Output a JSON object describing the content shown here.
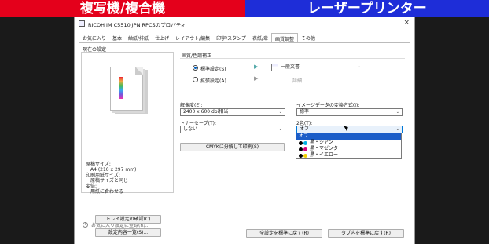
{
  "banners": {
    "left": "複写機/複合機",
    "right": "レーザープリンター"
  },
  "window": {
    "title": "RICOH IM C5510 JPN RPCSのプロパティ",
    "close": "×"
  },
  "tabs": [
    "お気に入り",
    "基本",
    "給紙/排紙",
    "仕上げ",
    "レイアウト/編集",
    "印字/スタンプ",
    "表紙/章",
    "画質調整",
    "その他"
  ],
  "active_tab": "画質調整",
  "left_panel": {
    "preview_label": "現在の設定",
    "info": [
      "原稿サイズ:",
      "A4 (210 x 297 mm)",
      "印刷用紙サイズ:",
      "原稿サイズと同じ",
      "変倍:",
      "用紙に合わせる"
    ],
    "favorites_link": "お気に入り設定に登録(R)...",
    "tray_button": "トレイ設定の確認(C)",
    "list_button": "設定内容一覧(S)..."
  },
  "quality": {
    "group_title": "画質/色調補正",
    "standard_label": "標準設定(S)",
    "standard_value": "一般文書",
    "extended_label": "拡張設定(A)",
    "detail_label": "詳細..."
  },
  "resolution": {
    "label": "解像度(E):",
    "value": "2400 x 600 dpi相当"
  },
  "image_method": {
    "label": "イメージデータの変換方式(J):",
    "value": "標準"
  },
  "toner_save": {
    "label": "トナーセーブ(T):",
    "value": "しない"
  },
  "two_color": {
    "label": "2色(T):",
    "value": "オフ",
    "options": [
      {
        "label": "オフ",
        "colors": []
      },
      {
        "label": "黒・シアン",
        "colors": [
          "#000000",
          "#00b0e0"
        ]
      },
      {
        "label": "黒・マゼンタ",
        "colors": [
          "#000000",
          "#d0007a"
        ]
      },
      {
        "label": "黒・イエロー",
        "colors": [
          "#000000",
          "#f0d000"
        ]
      }
    ]
  },
  "cmyk_button": "CMYKに分解して印刷(S)",
  "reset_all_button": "全設定を標準に戻す(R)",
  "reset_tab_button": "タブ内を標準に戻す(R)",
  "icons": {
    "arrow": "play-arrow-icon",
    "doc": "document-icon",
    "info": "info-icon"
  }
}
